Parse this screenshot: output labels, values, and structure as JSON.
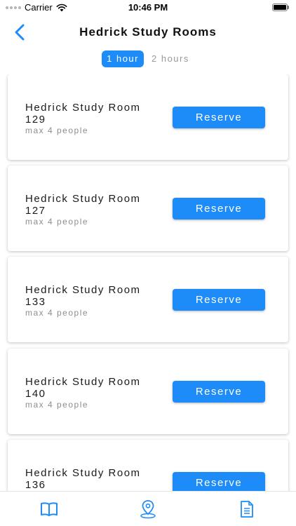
{
  "status_bar": {
    "carrier": "Carrier",
    "time": "10:46 PM",
    "icons": [
      "signal-dots-icon",
      "wifi-icon",
      "battery-icon"
    ]
  },
  "nav": {
    "back_icon": "chevron-left-icon",
    "title": "Hedrick Study Rooms"
  },
  "duration_tabs": [
    {
      "label": "1 hour",
      "selected": true
    },
    {
      "label": "2 hours",
      "selected": false
    }
  ],
  "rooms": [
    {
      "name": "Hedrick Study Room 129",
      "capacity": "max 4 people",
      "action": "Reserve"
    },
    {
      "name": "Hedrick Study Room 127",
      "capacity": "max 4 people",
      "action": "Reserve"
    },
    {
      "name": "Hedrick Study Room 133",
      "capacity": "max 4 people",
      "action": "Reserve"
    },
    {
      "name": "Hedrick Study Room 140",
      "capacity": "max 4 people",
      "action": "Reserve"
    },
    {
      "name": "Hedrick Study Room 136",
      "capacity": "",
      "action": "Reserve"
    }
  ],
  "tab_bar": {
    "items": [
      {
        "icon": "book-icon",
        "selected": true
      },
      {
        "icon": "map-pin-icon",
        "selected": false
      },
      {
        "icon": "document-icon",
        "selected": false
      }
    ]
  },
  "colors": {
    "accent": "#1d8cf8",
    "muted_text": "#8e8e8e",
    "card_bg": "#ffffff"
  }
}
